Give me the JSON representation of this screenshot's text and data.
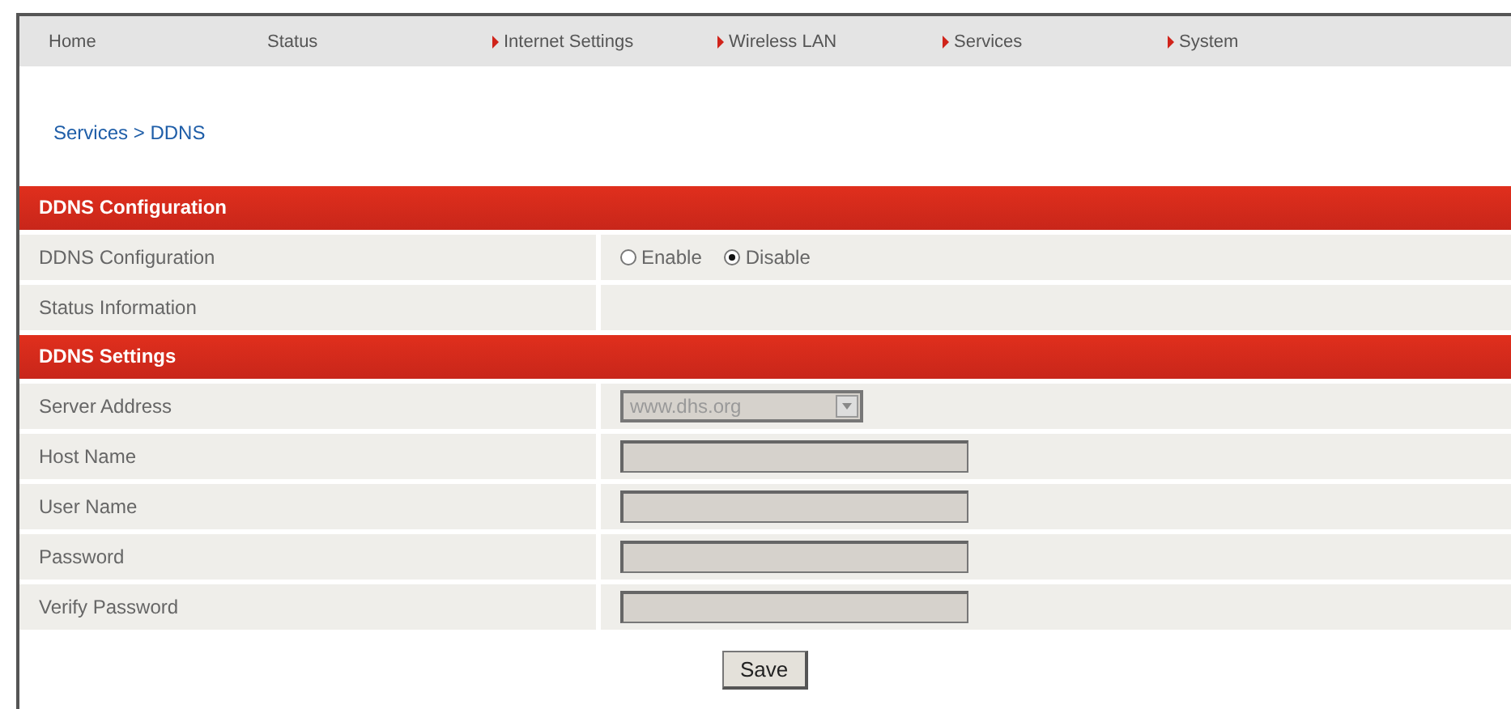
{
  "nav": [
    {
      "label": "Home",
      "kind": "plain"
    },
    {
      "label": "Status",
      "kind": "plain"
    },
    {
      "label": "Internet Settings",
      "kind": "arrow"
    },
    {
      "label": "Wireless LAN",
      "kind": "arrow"
    },
    {
      "label": "Services",
      "kind": "arrow"
    },
    {
      "label": "System",
      "kind": "arrow"
    }
  ],
  "breadcrumb": "Services > DDNS",
  "sections": [
    {
      "title": "DDNS Configuration",
      "rows": [
        {
          "label": "DDNS Configuration",
          "kind": "radio",
          "options": [
            {
              "label": "Enable",
              "selected": false
            },
            {
              "label": "Disable",
              "selected": true
            }
          ]
        },
        {
          "label": "Status Information",
          "kind": "empty"
        }
      ]
    },
    {
      "title": "DDNS Settings",
      "rows": [
        {
          "label": "Server Address",
          "kind": "select",
          "value": "www.dhs.org",
          "disabled": true
        },
        {
          "label": "Host Name",
          "kind": "text",
          "disabled": true
        },
        {
          "label": "User Name",
          "kind": "text",
          "disabled": true
        },
        {
          "label": "Password",
          "kind": "text",
          "disabled": true
        },
        {
          "label": "Verify Password",
          "kind": "text",
          "disabled": true
        }
      ]
    }
  ],
  "save_button": "Save"
}
